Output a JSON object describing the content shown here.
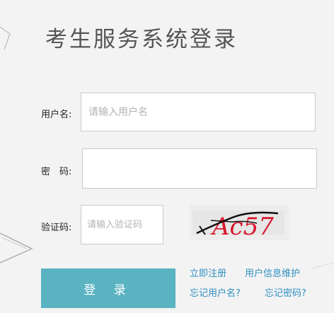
{
  "title": "考生服务系统登录",
  "form": {
    "username_label": "用户名:",
    "username_placeholder": "请输入用户名",
    "password_label": "密　码:",
    "password_placeholder": "",
    "captcha_label": "验证码:",
    "captcha_placeholder": "请输入验证码",
    "captcha_text": "Ac57"
  },
  "login_button": "登 录",
  "links": {
    "register": "立即注册",
    "user_info": "用户信息维护",
    "forgot_username": "忘记用户名?",
    "forgot_password": "忘记密码?"
  }
}
